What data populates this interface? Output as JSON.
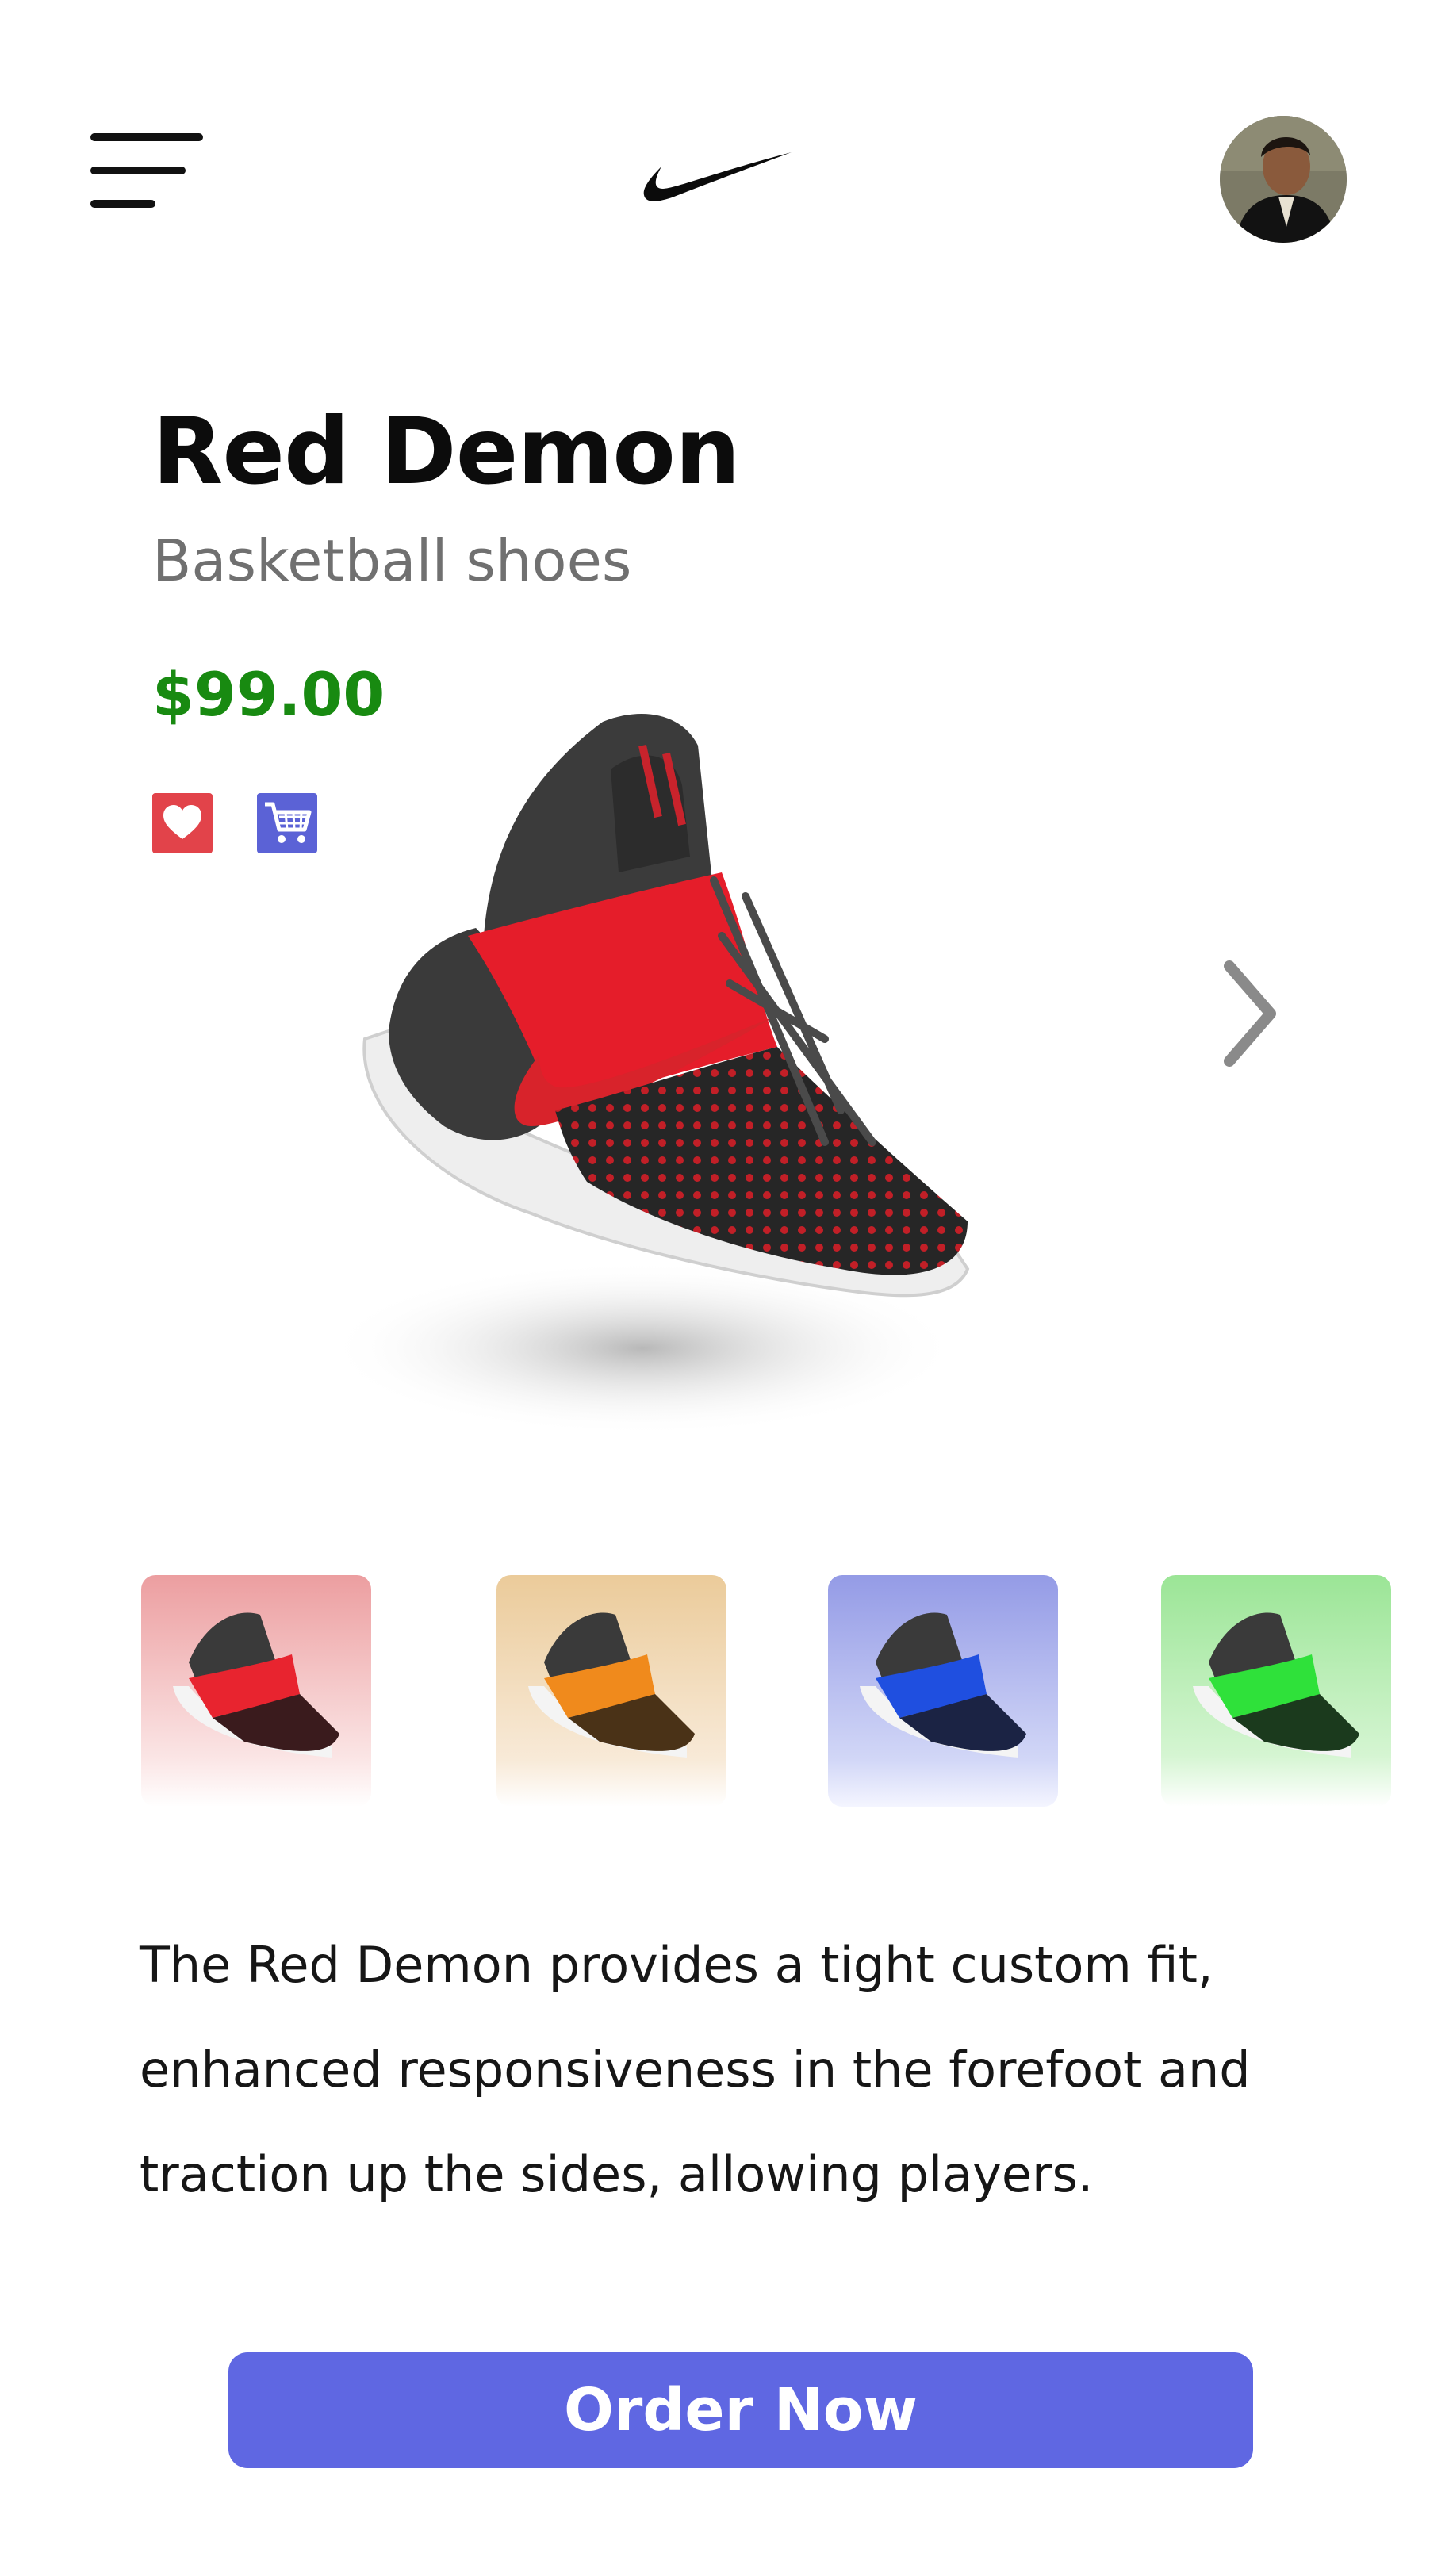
{
  "header": {
    "menu_icon": "hamburger-menu-icon",
    "logo_icon": "nike-swoosh-icon",
    "avatar": "profile-avatar"
  },
  "product": {
    "name": "Red Demon",
    "category": "Basketball shoes",
    "price": "$99.00",
    "favorite_icon": "heart-icon",
    "cart_icon": "shopping-cart-icon",
    "description": "The Red Demon provides  a tight custom fit, enhanced responsiveness in the forefoot and traction up the sides, allowing players."
  },
  "carousel": {
    "next_icon": "chevron-right-icon"
  },
  "variants": [
    {
      "color_name": "red",
      "accent": "#e8242f"
    },
    {
      "color_name": "orange",
      "accent": "#f08a1c"
    },
    {
      "color_name": "blue",
      "accent": "#1f4fe0"
    },
    {
      "color_name": "green",
      "accent": "#2fe13a"
    }
  ],
  "colors": {
    "accent": "#5f67e2",
    "price": "#188a11",
    "favorite": "#e2434a",
    "cart": "#5b62d6"
  },
  "cta": {
    "order_label": "Order Now"
  }
}
